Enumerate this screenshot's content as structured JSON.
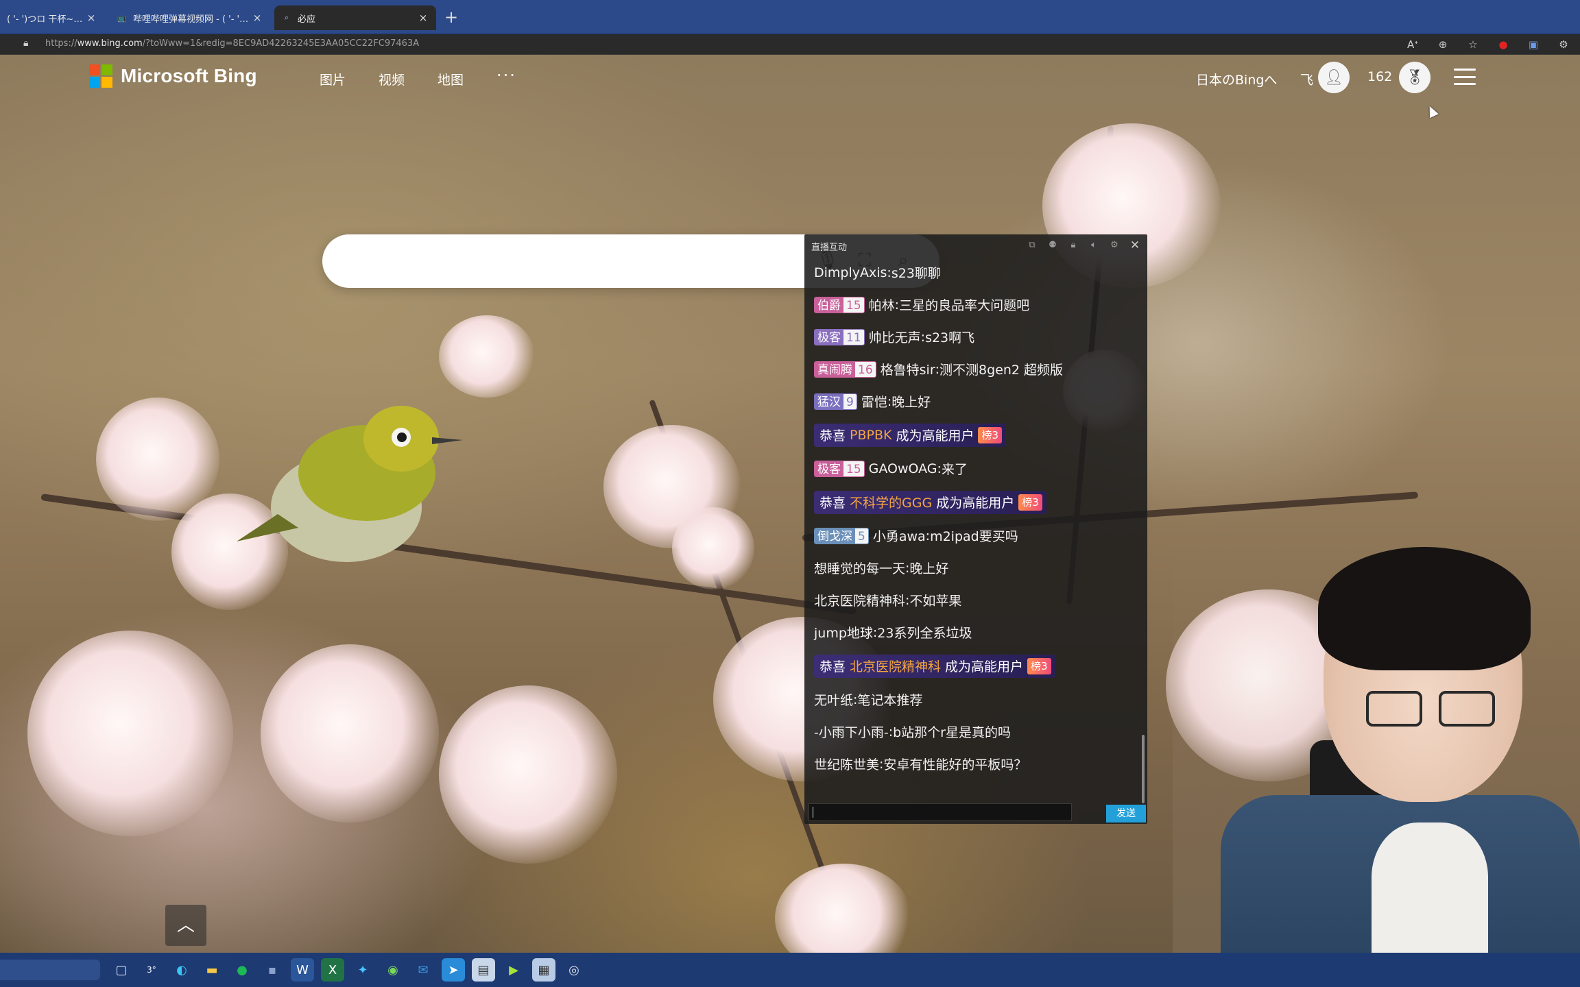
{
  "browser": {
    "tabs": [
      {
        "title": "( '- ')つロ 干杯~-bili",
        "active": false
      },
      {
        "title": "哔哩哔哩弹幕视频网 - ( '- ')つ",
        "active": false
      },
      {
        "title": "必应",
        "active": true
      }
    ],
    "new_tab_symbol": "+",
    "close_symbol": "×",
    "url_prefix": "https://",
    "url_host": "www.bing.com",
    "url_rest": "/?toWww=1&redig=8EC9AD42263245E3AA05CC22FC97463A"
  },
  "bing": {
    "logo_text": "Microsoft Bing",
    "logo_colors": [
      "#f25022",
      "#7fba00",
      "#00a4ef",
      "#ffb900"
    ],
    "nav": [
      "图片",
      "视频",
      "地图"
    ],
    "more_label": "···",
    "region_link": "日本のBingへ",
    "user_name": "飞",
    "points": "162"
  },
  "danmaku": {
    "title": "直播互动",
    "send_label": "发送",
    "messages": [
      {
        "type": "chat",
        "user": "DimplyAxis",
        "text": "s23聊聊"
      },
      {
        "type": "chat",
        "medal": "伯爵",
        "level": "15",
        "medal_color": "#c9609a",
        "user": "帕林",
        "text": "三星的良品率大问题吧"
      },
      {
        "type": "chat",
        "medal": "极客",
        "level": "11",
        "medal_color": "#8a6fbf",
        "user": "帅比无声",
        "text": "s23啊飞"
      },
      {
        "type": "chat",
        "medal": "真闹腾",
        "level": "16",
        "medal_color": "#c9609a",
        "user": "格鲁特sir",
        "text": "测不测8gen2 超频版"
      },
      {
        "type": "chat",
        "medal": "猛汉",
        "level": "9",
        "medal_color": "#7b6fbf",
        "user": "雷恺",
        "text": "晚上好"
      },
      {
        "type": "gift",
        "prefix": "恭喜",
        "user": "PBPBK",
        "text": "成为高能用户",
        "badge": "榜3"
      },
      {
        "type": "chat",
        "medal": "极客",
        "level": "15",
        "medal_color": "#c9609a",
        "user": "GAOwOAG",
        "text": "来了"
      },
      {
        "type": "gift",
        "prefix": "恭喜",
        "user": "不科学的GGG",
        "text": "成为高能用户",
        "badge": "榜3"
      },
      {
        "type": "chat",
        "medal": "倒戈深",
        "level": "5",
        "medal_color": "#6a8fb8",
        "user": "小勇awa",
        "text": "m2ipad要买吗"
      },
      {
        "type": "chat",
        "user": "想睡觉的每一天",
        "text": "晚上好"
      },
      {
        "type": "chat",
        "user": "北京医院精神科",
        "text": "不如苹果"
      },
      {
        "type": "chat",
        "user": "jump地球",
        "text": "23系列全系垃圾"
      },
      {
        "type": "gift",
        "prefix": "恭喜",
        "user": "北京医院精神科",
        "text": "成为高能用户",
        "badge": "榜3"
      },
      {
        "type": "chat",
        "user": "无叶纸",
        "text": "笔记本推荐"
      },
      {
        "type": "chat",
        "user": "-小雨下小雨-",
        "text": "b站那个r星是真的吗"
      },
      {
        "type": "chat",
        "user": "世纪陈世美",
        "text": "安卓有性能好的平板吗？"
      }
    ]
  },
  "icons": {
    "lock": "lock-icon",
    "search_icons": [
      "microphone-icon",
      "visual-search-icon",
      "search-icon"
    ],
    "taskbar": [
      "task-view-icon",
      "weather-icon",
      "edge-icon",
      "file-explorer-icon",
      "spotify-icon",
      "app-icon",
      "word-icon",
      "excel-icon",
      "app-store-icon",
      "wechat-icon",
      "mail-icon",
      "messenger-icon",
      "app-icon-2",
      "app-icon-3",
      "app-icon-4",
      "obs-icon"
    ]
  },
  "weather_temp": "3°"
}
